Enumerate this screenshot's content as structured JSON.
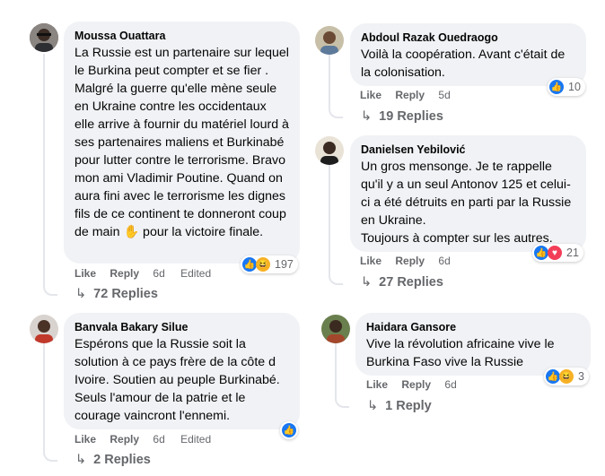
{
  "comments": [
    {
      "author": "Moussa Ouattara",
      "text": "La Russie est un partenaire sur lequel le Burkina peut compter et se fier . Malgré la guerre qu'elle mène seule en Ukraine contre les occidentaux elle arrive à fournir du matériel lourd à ses partenaires maliens et Burkinabé pour lutter contre le terrorisme. Bravo mon ami Vladimir Poutine. Quand on aura fini avec le terrorisme les dignes fils de ce continent te donneront coup de main",
      "text_tail": " pour la victoire finale.",
      "emoji": "✋",
      "like": "Like",
      "reply": "Reply",
      "time": "6d",
      "edited": "Edited",
      "reaction_count": "197",
      "reaction_icons": [
        "like-icon",
        "haha-icon"
      ],
      "replies": "72 Replies"
    },
    {
      "author": "Abdoul Razak Ouedraogo",
      "text": "Voilà la coopération. Avant c'était de la colonisation.",
      "like": "Like",
      "reply": "Reply",
      "time": "5d",
      "reaction_count": "10",
      "reaction_icons": [
        "like-icon"
      ],
      "replies": "19 Replies"
    },
    {
      "author": "Danielsen Yebilović",
      "text": "Un gros mensonge. Je te rappelle qu'il y a un seul Antonov 125 et celui-ci a été détruits en parti par la Russie en Ukraine.",
      "text2": "Toujours à compter sur les autres.",
      "like": "Like",
      "reply": "Reply",
      "time": "6d",
      "reaction_count": "21",
      "reaction_icons": [
        "like-icon",
        "love-icon"
      ],
      "replies": "27 Replies"
    },
    {
      "author": "Banvala Bakary Silue",
      "text": "Espérons que la Russie soit la solution à ce pays frère de la côte d Ivoire. Soutien au peuple Burkinabé. Seuls l'amour de la patrie et le courage vaincront l'ennemi.",
      "like": "Like",
      "reply": "Reply",
      "time": "6d",
      "edited": "Edited",
      "reaction_icons": [
        "like-icon"
      ],
      "replies": "2 Replies"
    },
    {
      "author": "Haidara Gansore",
      "text": "Vive la révolution africaine vive le Burkina Faso vive la Russie",
      "like": "Like",
      "reply": "Reply",
      "time": "6d",
      "reaction_count": "3",
      "reaction_icons": [
        "like-icon",
        "haha-icon"
      ],
      "replies": "1 Reply"
    }
  ],
  "colors": {
    "bubble": "#f0f2f5",
    "meta": "#65676b",
    "like_blue": "#1877f2",
    "love_red": "#f33e58",
    "haha_yellow": "#f7b125"
  }
}
